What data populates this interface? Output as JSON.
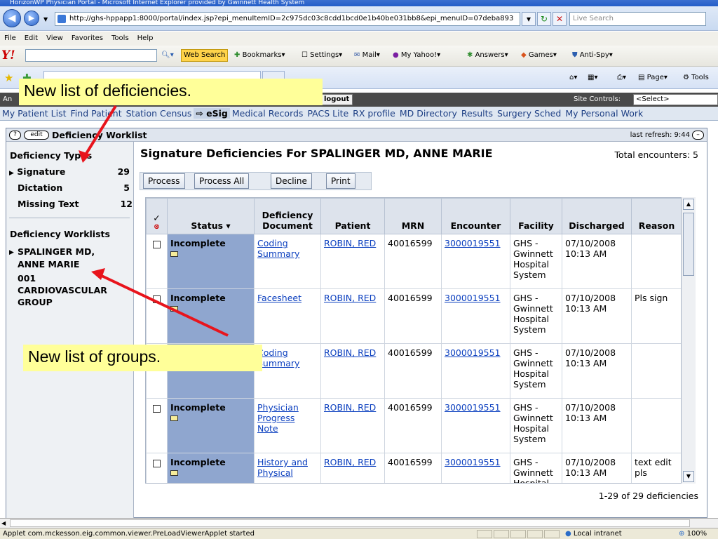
{
  "browser": {
    "title": "HorizonWP Physician Portal - Microsoft Internet Explorer provided by Gwinnett Health System",
    "address": "http://ghs-hppapp1:8000/portal/index.jsp?epi_menuItemID=2c975dc03c8cdd1bcd0e1b40be031bb8&epi_menuID=07deba893",
    "live_search_placeholder": "Live Search",
    "menu": [
      "File",
      "Edit",
      "View",
      "Favorites",
      "Tools",
      "Help"
    ],
    "yahoo_toolbar": {
      "web_search": "Web Search",
      "bookmarks": "Bookmarks",
      "settings": "Settings",
      "mail": "Mail",
      "my_yahoo": "My Yahoo!",
      "answers": "Answers",
      "games": "Games",
      "anti_spy": "Anti-Spy"
    },
    "tab_label": "HorizonWP Physician Portal",
    "right_tools": {
      "page": "Page",
      "tools": "Tools"
    }
  },
  "portal": {
    "header_left": "An",
    "logout": "logout",
    "site_controls_label": "Site Controls:",
    "site_controls_value": "<Select>",
    "nav": [
      {
        "label": "My Patient List",
        "selected": false
      },
      {
        "label": "Find Patient",
        "selected": false
      },
      {
        "label": "Station Census",
        "selected": false
      },
      {
        "label": "eSig",
        "selected": true
      },
      {
        "label": "Medical Records",
        "selected": false
      },
      {
        "label": "PACS Lite",
        "selected": false
      },
      {
        "label": "RX profile",
        "selected": false
      },
      {
        "label": "MD Directory",
        "selected": false
      },
      {
        "label": "Results",
        "selected": false
      },
      {
        "label": "Surgery Sched",
        "selected": false
      },
      {
        "label": "My Personal Work",
        "selected": false
      }
    ]
  },
  "worklist": {
    "help": "?",
    "edit": "edit",
    "title": "Deficiency Worklist",
    "last_refresh": "last refresh: 9:44",
    "deficiency_types_heading": "Deficiency Types",
    "deficiency_types": [
      {
        "label": "Signature",
        "count": "29",
        "selected": true
      },
      {
        "label": "Dictation",
        "count": "5",
        "selected": false
      },
      {
        "label": "Missing Text",
        "count": "12",
        "selected": false
      }
    ],
    "worklists_heading": "Deficiency Worklists",
    "worklists": [
      "SPALINGER MD, ANNE MARIE",
      "001 CARDIOVASCULAR GROUP"
    ],
    "main_title": "Signature Deficiencies For SPALINGER MD, ANNE MARIE",
    "total_encounters": "Total encounters: 5",
    "buttons": {
      "process": "Process",
      "process_all": "Process All",
      "decline": "Decline",
      "print": "Print"
    },
    "columns": {
      "check": "✓",
      "status": "Status ▾",
      "document": "Deficiency Document",
      "patient": "Patient",
      "mrn": "MRN",
      "encounter": "Encounter",
      "facility": "Facility",
      "discharged": "Discharged",
      "reason": "Reason"
    },
    "rows": [
      {
        "status": "Incomplete",
        "document": "Coding Summary",
        "patient": "ROBIN, RED",
        "mrn": "40016599",
        "encounter": "3000019551",
        "facility": "GHS - Gwinnett Hospital System",
        "discharged": "07/10/2008 10:13 AM",
        "reason": ""
      },
      {
        "status": "Incomplete",
        "document": "Facesheet",
        "patient": "ROBIN, RED",
        "mrn": "40016599",
        "encounter": "3000019551",
        "facility": "GHS - Gwinnett Hospital System",
        "discharged": "07/10/2008 10:13 AM",
        "reason": "Pls sign"
      },
      {
        "status": "Incomplete",
        "document": "Coding Summary",
        "patient": "ROBIN, RED",
        "mrn": "40016599",
        "encounter": "3000019551",
        "facility": "GHS - Gwinnett Hospital System",
        "discharged": "07/10/2008 10:13 AM",
        "reason": ""
      },
      {
        "status": "Incomplete",
        "document": "Physician Progress Note",
        "patient": "ROBIN, RED",
        "mrn": "40016599",
        "encounter": "3000019551",
        "facility": "GHS - Gwinnett Hospital System",
        "discharged": "07/10/2008 10:13 AM",
        "reason": ""
      },
      {
        "status": "Incomplete",
        "document": "History and Physical",
        "patient": "ROBIN, RED",
        "mrn": "40016599",
        "encounter": "3000019551",
        "facility": "GHS - Gwinnett Hospital",
        "discharged": "07/10/2008 10:13 AM",
        "reason": "text edit pls"
      }
    ],
    "pagination": "1-29 of 29 deficiencies"
  },
  "statusbar": {
    "text": "Applet com.mckesson.eig.common.viewer.PreLoadViewerApplet started",
    "zone": "Local intranet",
    "zoom": "100%"
  },
  "annotations": {
    "deficiencies_callout": "New list of deficiencies.",
    "groups_callout": "New list of groups.",
    "color": "#e8141c"
  }
}
